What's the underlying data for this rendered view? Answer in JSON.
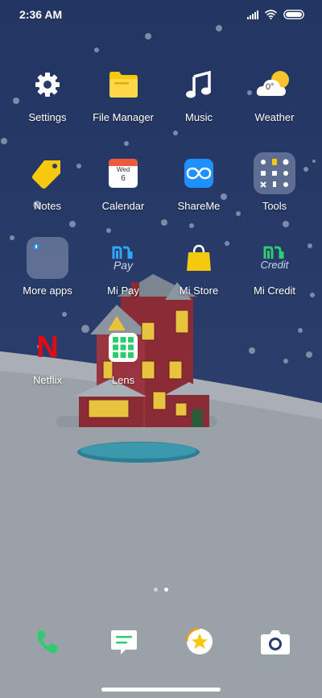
{
  "status_bar": {
    "time": "2:36 AM",
    "icons": [
      "signal-icon",
      "wifi-icon",
      "battery-icon"
    ]
  },
  "apps": [
    {
      "label": "Settings",
      "icon": "gear-icon"
    },
    {
      "label": "File Manager",
      "icon": "folder-icon"
    },
    {
      "label": "Music",
      "icon": "music-note-icon"
    },
    {
      "label": "Weather",
      "icon": "weather-icon",
      "temp": "0°"
    },
    {
      "label": "Notes",
      "icon": "tag-icon"
    },
    {
      "label": "Calendar",
      "icon": "calendar-icon",
      "day_name": "Wed",
      "day_number": "6"
    },
    {
      "label": "ShareMe",
      "icon": "shareme-icon"
    },
    {
      "label": "Tools",
      "icon": "tools-folder-icon"
    },
    {
      "label": "More apps",
      "icon": "folder-icon"
    },
    {
      "label": "Mi Pay",
      "icon": "mi-pay-icon",
      "logo_text": "Pay"
    },
    {
      "label": "Mi Store",
      "icon": "shopping-bag-icon"
    },
    {
      "label": "Mi Credit",
      "icon": "mi-credit-icon",
      "logo_text": "Credit"
    },
    {
      "label": "Netflix",
      "icon": "netflix-icon",
      "logo_text": "N"
    },
    {
      "label": "Lens",
      "icon": "lens-grid-icon"
    }
  ],
  "page_indicator": {
    "count": 2,
    "active": 2
  },
  "dock": [
    {
      "icon": "phone-icon"
    },
    {
      "icon": "messages-icon"
    },
    {
      "icon": "browser-star-icon"
    },
    {
      "icon": "camera-icon"
    }
  ],
  "colors": {
    "sky": "#2b3d6a",
    "snow": "#9da3a9",
    "house": "#8d2e37",
    "accent_green": "#2ecc71"
  }
}
